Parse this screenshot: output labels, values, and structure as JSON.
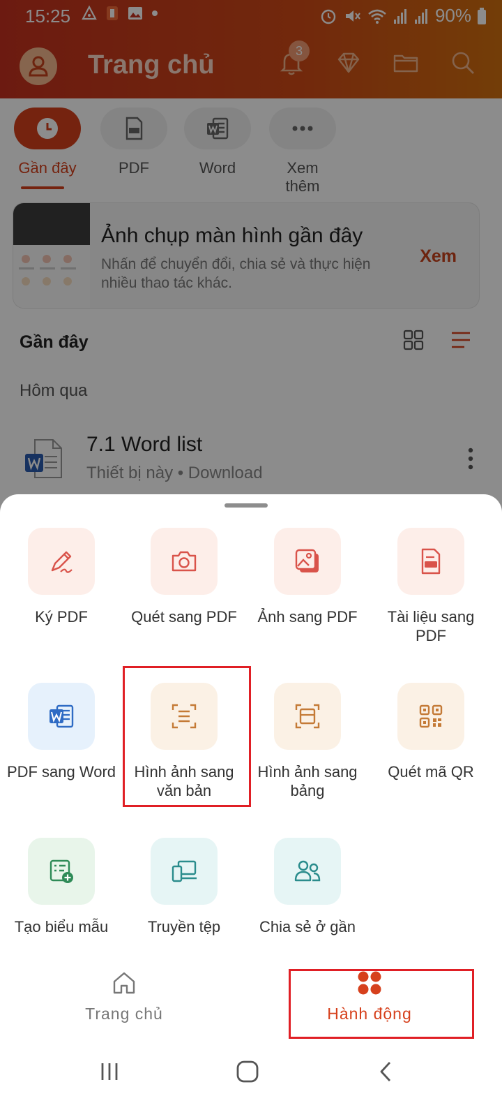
{
  "status_bar": {
    "time": "15:25",
    "battery": "90%"
  },
  "header": {
    "title": "Trang chủ",
    "notification_count": "3"
  },
  "categories": [
    {
      "label": "Gần đây",
      "icon": "clock-icon",
      "active": true
    },
    {
      "label": "PDF",
      "icon": "pdf-file-icon",
      "active": false
    },
    {
      "label": "Word",
      "icon": "word-icon",
      "active": false
    },
    {
      "label": "Xem thêm",
      "icon": "more-icon",
      "active": false
    }
  ],
  "promo": {
    "title": "Ảnh chụp màn hình gần đây",
    "description": "Nhấn để chuyển đổi, chia sẻ và thực hiện nhiều thao tác khác.",
    "action": "Xem"
  },
  "recent": {
    "title": "Gần đây",
    "group_label": "Hôm qua",
    "files": [
      {
        "name": "7.1 Word list",
        "meta": "Thiết bị này • Download"
      }
    ]
  },
  "actions": [
    {
      "label": "Ký PDF",
      "icon": "signature-icon",
      "color": "#d9534a"
    },
    {
      "label": "Quét sang PDF",
      "icon": "camera-icon",
      "color": "#d9534a"
    },
    {
      "label": "Ảnh sang PDF",
      "icon": "image-icon",
      "color": "#d9534a"
    },
    {
      "label": "Tài liệu sang PDF",
      "icon": "pdf-doc-icon",
      "color": "#d9534a"
    },
    {
      "label": "PDF sang Word",
      "icon": "word-icon",
      "color": "#2e6bc4"
    },
    {
      "label": "Hình ảnh sang văn bản",
      "icon": "text-scan-icon",
      "color": "#c47a36"
    },
    {
      "label": "Hình ảnh sang bảng",
      "icon": "table-scan-icon",
      "color": "#c47a36"
    },
    {
      "label": "Quét mã QR",
      "icon": "qr-code-icon",
      "color": "#c47a36"
    },
    {
      "label": "Tạo biểu mẫu",
      "icon": "form-add-icon",
      "color": "#2e8b57"
    },
    {
      "label": "Truyền tệp",
      "icon": "devices-icon",
      "color": "#2a8c8c"
    },
    {
      "label": "Chia sẻ ở gần",
      "icon": "people-icon",
      "color": "#2a8c8c"
    }
  ],
  "bottom_nav": [
    {
      "label": "Trang chủ",
      "icon": "home-icon",
      "active": false
    },
    {
      "label": "Hành động",
      "icon": "actions-grid-icon",
      "active": true
    }
  ],
  "colors": {
    "brand": "#d6401c",
    "highlight": "#e01f25"
  }
}
